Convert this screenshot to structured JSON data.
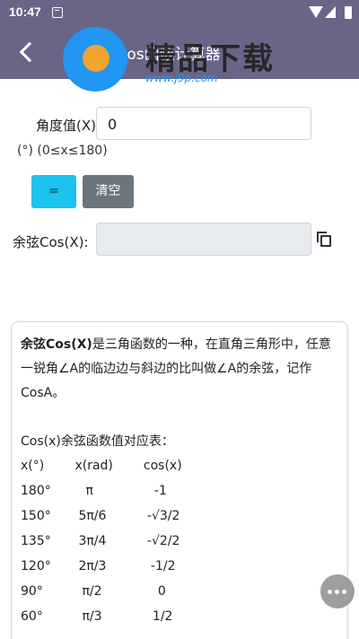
{
  "status": {
    "time": "10:47"
  },
  "appbar": {
    "title": "cos函数计算器"
  },
  "watermark": {
    "text": "精品下载",
    "url": "www.j9p.com"
  },
  "form": {
    "angle_label": "角度值(X):",
    "angle_value": "0",
    "range_hint": "(°) (0≤x≤180)",
    "equals_label": "=",
    "clear_label": "清空",
    "result_label": "余弦Cos(X):",
    "result_value": ""
  },
  "info": {
    "bold_term": "余弦Cos(X)",
    "description": "是三角函数的一种，在直角三角形中，任意一锐角∠A的临边边与斜边的比叫做∠A的余弦，记作CosA。",
    "table_title": "Cos(x)余弦函数值对应表：",
    "headers": [
      "x(°)",
      "x(rad)",
      "cos(x)"
    ],
    "rows": [
      [
        "180°",
        "π",
        "-1"
      ],
      [
        "150°",
        "5π/6",
        "-√3/2"
      ],
      [
        "135°",
        "3π/4",
        "-√2/2"
      ],
      [
        "120°",
        "2π/3",
        "-1/2"
      ],
      [
        "90°",
        "π/2",
        "0"
      ],
      [
        "60°",
        "π/3",
        "1/2"
      ]
    ]
  },
  "icons": {
    "back": "arrow-left",
    "copy": "copy",
    "chat": "chat-bubble"
  }
}
